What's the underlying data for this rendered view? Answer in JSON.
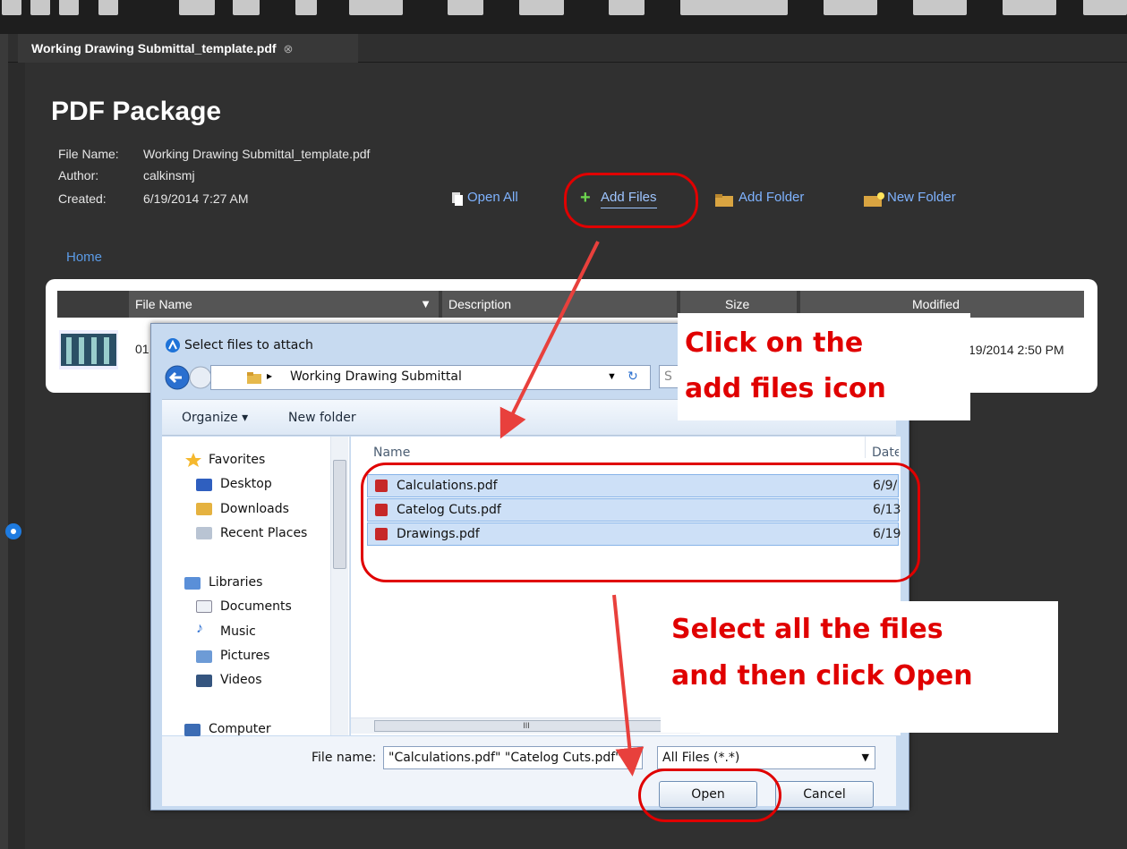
{
  "tab": {
    "title": "Working Drawing Submittal_template.pdf",
    "close": "⊗"
  },
  "package": {
    "title": "PDF Package",
    "file_name_label": "File Name:",
    "file_name": "Working Drawing Submittal_template.pdf",
    "author_label": "Author:",
    "author": "calkinsmj",
    "created_label": "Created:",
    "created": "6/19/2014 7:27 AM",
    "open_all": "Open All",
    "add_files": "Add Files",
    "add_folder": "Add Folder",
    "new_folder": "New Folder",
    "home": "Home"
  },
  "table": {
    "headers": {
      "file_name": "File Name",
      "description": "Description",
      "size": "Size",
      "modified": "Modified"
    },
    "row": {
      "name_prefix": "01",
      "modified": "19/2014 2:50 PM"
    }
  },
  "dialog": {
    "title": "Select files to attach",
    "path": "Working Drawing Submittal",
    "search": "S",
    "organize": "Organize ▾",
    "new_folder": "New folder",
    "col_name": "Name",
    "col_date": "Date",
    "nav": {
      "favorites": "Favorites",
      "desktop": "Desktop",
      "downloads": "Downloads",
      "recent": "Recent Places",
      "libraries": "Libraries",
      "documents": "Documents",
      "music": "Music",
      "pictures": "Pictures",
      "videos": "Videos",
      "computer": "Computer"
    },
    "files": [
      {
        "name": "Calculations.pdf",
        "date": "6/9/"
      },
      {
        "name": "Catelog Cuts.pdf",
        "date": "6/13"
      },
      {
        "name": "Drawings.pdf",
        "date": "6/19"
      }
    ],
    "file_name_label": "File name:",
    "file_name_value": "\"Calculations.pdf\" \"Catelog Cuts.pdf\"",
    "file_type": "All Files (*.*)",
    "open": "Open",
    "cancel": "Cancel",
    "hscroll": "III"
  },
  "callouts": {
    "add_files_1": "Click on the",
    "add_files_2": "add files icon",
    "select_1": "Select all the files",
    "select_2": "and then click Open"
  },
  "colors": {
    "callout": "#e00000",
    "selection": "#cde0f7",
    "link": "#7fb3ff"
  }
}
